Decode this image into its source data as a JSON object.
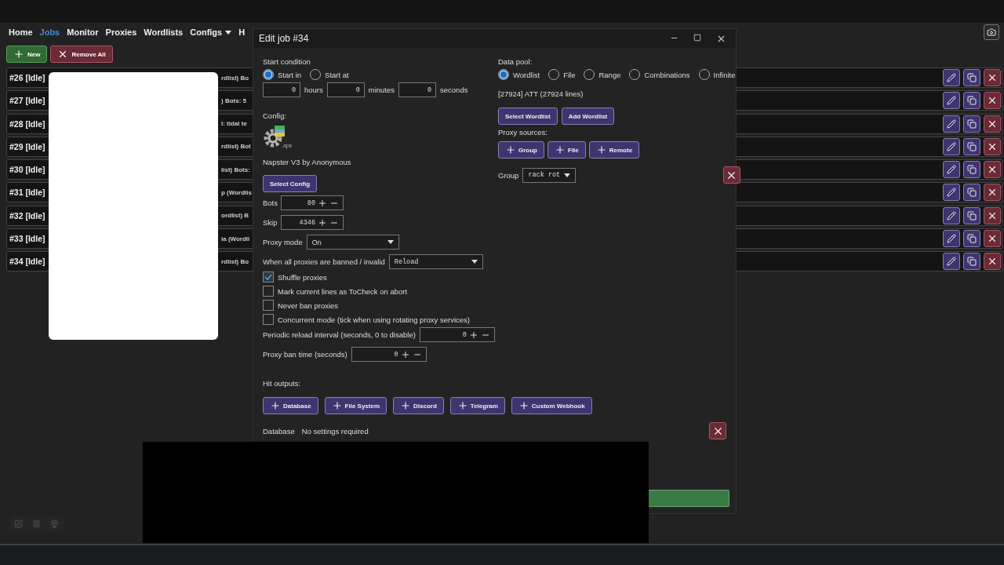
{
  "nav": {
    "items": [
      {
        "label": "Home",
        "selected": false,
        "dropdown": false
      },
      {
        "label": "Jobs",
        "selected": true,
        "dropdown": false
      },
      {
        "label": "Monitor",
        "selected": false,
        "dropdown": false
      },
      {
        "label": "Proxies",
        "selected": false,
        "dropdown": false
      },
      {
        "label": "Wordlists",
        "selected": false,
        "dropdown": false
      },
      {
        "label": "Configs",
        "selected": false,
        "dropdown": true
      },
      {
        "label": "H",
        "selected": false,
        "dropdown": false
      }
    ]
  },
  "toolbar": {
    "new": "New",
    "remove_all": "Remove All"
  },
  "jobs": [
    {
      "label": "#26 [Idle]",
      "fragment": "rdlist) Bo"
    },
    {
      "label": "#27 [Idle]",
      "fragment": ") Bots: 5"
    },
    {
      "label": "#28 [Idle]",
      "fragment": "l: tidal te"
    },
    {
      "label": "#29 [Idle]",
      "fragment": "rdlist) Bot"
    },
    {
      "label": "#30 [Idle]",
      "fragment": "list) Bots:"
    },
    {
      "label": "#31 [Idle]",
      "fragment": "p (Wordlis"
    },
    {
      "label": "#32 [Idle]",
      "fragment": "ordlist) B"
    },
    {
      "label": "#33 [Idle]",
      "fragment": "ia (Wordli"
    },
    {
      "label": "#34 [Idle]",
      "fragment": "rdlist) Bo"
    }
  ],
  "modal": {
    "title": "Edit job #34",
    "start_condition": {
      "label": "Start condition",
      "options": [
        {
          "label": "Start in",
          "selected": true
        },
        {
          "label": "Start at",
          "selected": false
        }
      ],
      "fields": [
        {
          "value": "0",
          "unit": "hours"
        },
        {
          "value": "0",
          "unit": "minutes"
        },
        {
          "value": "0",
          "unit": "seconds"
        }
      ]
    },
    "config": {
      "label": "Config:",
      "icon_caption": ".apk",
      "name": "Napster V3 by Anonymous",
      "button": "Select Config"
    },
    "bots": {
      "label": "Bots",
      "value": "80"
    },
    "skip": {
      "label": "Skip",
      "value": "4346"
    },
    "proxy_mode": {
      "label": "Proxy mode",
      "value": "On"
    },
    "banned": {
      "label": "When all proxies are banned / invalid",
      "value": "Reload"
    },
    "checkboxes": [
      {
        "label": "Shuffle proxies",
        "checked": true
      },
      {
        "label": "Mark current lines as ToCheck on abort",
        "checked": false
      },
      {
        "label": "Never ban proxies",
        "checked": false
      },
      {
        "label": "Concurrent mode (tick when using rotating proxy services)",
        "checked": false
      }
    ],
    "periodic": {
      "label": "Periodic reload interval (seconds, 0 to disable)",
      "value": "0"
    },
    "ban_time": {
      "label": "Proxy ban time (seconds)",
      "value": "0"
    },
    "data_pool": {
      "label": "Data pool:",
      "options": [
        {
          "label": "Wordlist",
          "selected": true
        },
        {
          "label": "File",
          "selected": false
        },
        {
          "label": "Range",
          "selected": false
        },
        {
          "label": "Combinations",
          "selected": false
        },
        {
          "label": "Infinite",
          "selected": false
        }
      ],
      "info": "[27924] ATT (27924 lines)",
      "buttons": [
        "Select Wordlist",
        "Add Wordlist"
      ]
    },
    "proxy_sources": {
      "label": "Proxy sources:",
      "buttons": [
        "Group",
        "File",
        "Remote"
      ],
      "group": {
        "label": "Group",
        "value": "rack rot"
      }
    },
    "hit_outputs": {
      "label": "Hit outputs:",
      "buttons": [
        "Database",
        "File System",
        "Discord",
        "Telegram",
        "Custom Webhook"
      ],
      "current": {
        "name": "Database",
        "note": "No settings required"
      }
    }
  }
}
